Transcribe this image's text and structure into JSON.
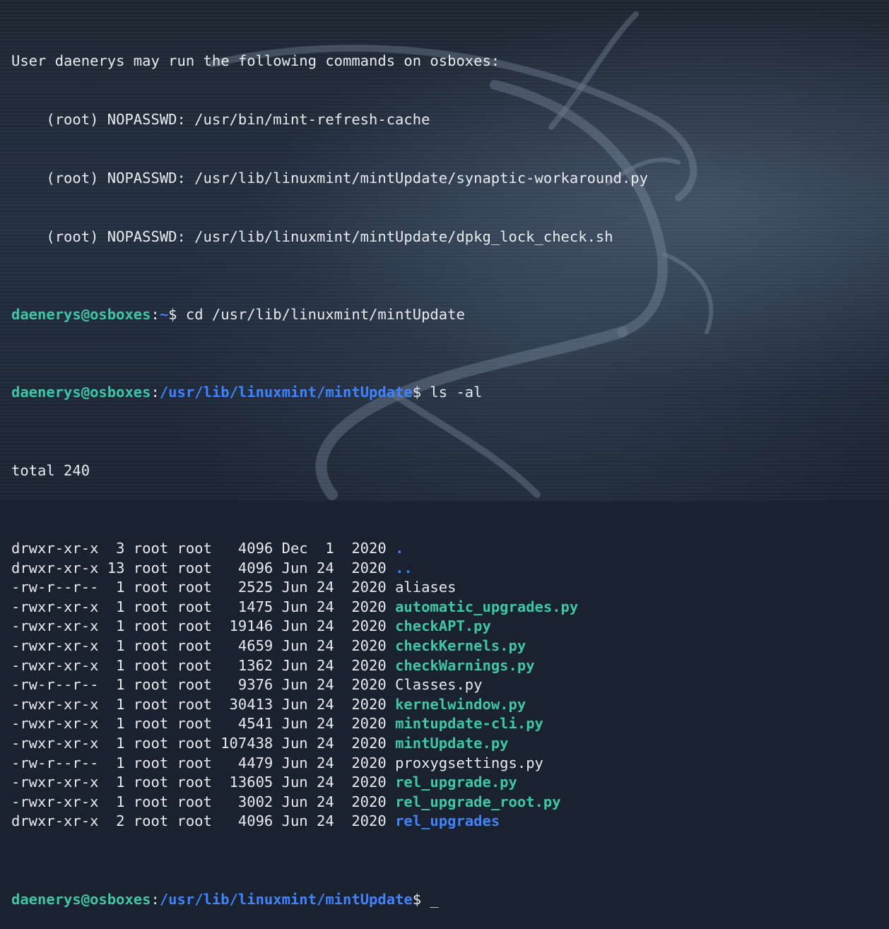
{
  "sudo_header": "User daenerys may run the following commands on osboxes:",
  "sudo_rules": [
    "    (root) NOPASSWD: /usr/bin/mint-refresh-cache",
    "    (root) NOPASSWD: /usr/lib/linuxmint/mintUpdate/synaptic-workaround.py",
    "    (root) NOPASSWD: /usr/lib/linuxmint/mintUpdate/dpkg_lock_check.sh"
  ],
  "prompt_user": "daenerys@osboxes",
  "prompts": [
    {
      "path": "~",
      "command": " cd /usr/lib/linuxmint/mintUpdate"
    },
    {
      "path": "/usr/lib/linuxmint/mintUpdate",
      "command": " ls -al"
    },
    {
      "path": "/usr/lib/linuxmint/mintUpdate",
      "command": " "
    }
  ],
  "total_line": "total 240",
  "listing": [
    {
      "meta": "drwxr-xr-x  3 root root   4096 Dec  1  2020 ",
      "name": ".",
      "kind": "dir"
    },
    {
      "meta": "drwxr-xr-x 13 root root   4096 Jun 24  2020 ",
      "name": "..",
      "kind": "dir"
    },
    {
      "meta": "-rw-r--r--  1 root root   2525 Jun 24  2020 ",
      "name": "aliases",
      "kind": "file"
    },
    {
      "meta": "-rwxr-xr-x  1 root root   1475 Jun 24  2020 ",
      "name": "automatic_upgrades.py",
      "kind": "exec"
    },
    {
      "meta": "-rwxr-xr-x  1 root root  19146 Jun 24  2020 ",
      "name": "checkAPT.py",
      "kind": "exec"
    },
    {
      "meta": "-rwxr-xr-x  1 root root   4659 Jun 24  2020 ",
      "name": "checkKernels.py",
      "kind": "exec"
    },
    {
      "meta": "-rwxr-xr-x  1 root root   1362 Jun 24  2020 ",
      "name": "checkWarnings.py",
      "kind": "exec"
    },
    {
      "meta": "-rw-r--r--  1 root root   9376 Jun 24  2020 ",
      "name": "Classes.py",
      "kind": "file"
    },
    {
      "meta": "-rwxr-xr-x  1 root root  30413 Jun 24  2020 ",
      "name": "kernelwindow.py",
      "kind": "exec"
    },
    {
      "meta": "-rwxr-xr-x  1 root root   4541 Jun 24  2020 ",
      "name": "mintupdate-cli.py",
      "kind": "exec"
    },
    {
      "meta": "-rwxr-xr-x  1 root root 107438 Jun 24  2020 ",
      "name": "mintUpdate.py",
      "kind": "exec"
    },
    {
      "meta": "-rw-r--r--  1 root root   4479 Jun 24  2020 ",
      "name": "proxygsettings.py",
      "kind": "file"
    },
    {
      "meta": "-rwxr-xr-x  1 root root  13605 Jun 24  2020 ",
      "name": "rel_upgrade.py",
      "kind": "exec"
    },
    {
      "meta": "-rwxr-xr-x  1 root root   3002 Jun 24  2020 ",
      "name": "rel_upgrade_root.py",
      "kind": "exec"
    },
    {
      "meta": "drwxr-xr-x  2 root root   4096 Jun 24  2020 ",
      "name": "rel_upgrades",
      "kind": "dir"
    }
  ],
  "prompt_symbol": "$",
  "prompt_colon": ":",
  "cursor": "_",
  "colors": {
    "prompt_user": "#3cc7a6",
    "path": "#3f83ff",
    "executable": "#3cc7a6",
    "directory": "#3f83ff",
    "text": "#e8ebef",
    "background": "#1f2733"
  },
  "background_icon": "kali-dragon-icon"
}
